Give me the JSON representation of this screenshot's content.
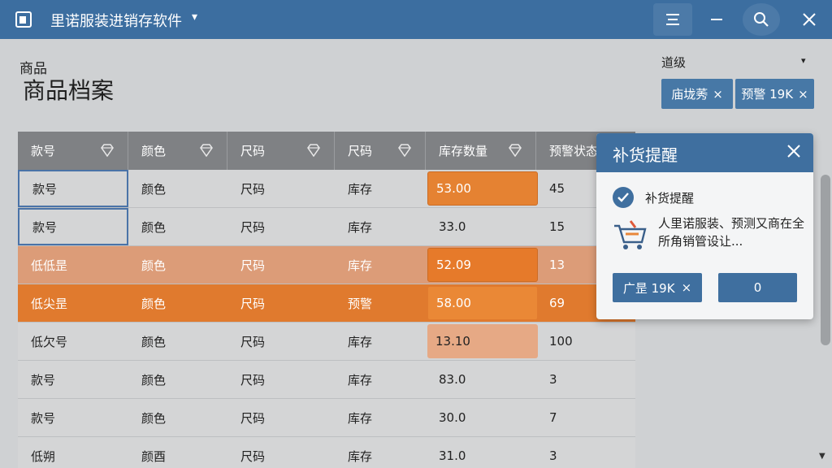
{
  "app": {
    "title": "里诺服装进销存软件",
    "title_caret": "▾"
  },
  "header": {
    "subtitle": "商品",
    "title": "商品档案"
  },
  "filter": {
    "label": "道级",
    "caret": "▾",
    "chips": [
      {
        "label": "庙垅莠",
        "close": "×"
      },
      {
        "label": "预警 19K",
        "close": "×"
      }
    ]
  },
  "table": {
    "columns": [
      {
        "label": "款号"
      },
      {
        "label": "颜色"
      },
      {
        "label": "尺码"
      },
      {
        "label": "尺码"
      },
      {
        "label": "库存数量"
      },
      {
        "label": "预警状态"
      }
    ],
    "rows": [
      {
        "c1": "款号",
        "c2": "颜色",
        "c3": "尺码",
        "c4": "库存",
        "qty": "53.00",
        "warn": "45",
        "style": "normal",
        "qty_style": "hl"
      },
      {
        "c1": "款号",
        "c2": "颜色",
        "c3": "尺码",
        "c4": "库存",
        "qty": "33.0",
        "warn": "15",
        "style": "normal",
        "qty_style": "none"
      },
      {
        "c1": "低低昰",
        "c2": "颜色",
        "c3": "尺码",
        "c4": "库存",
        "qty": "52.09",
        "warn": "13",
        "style": "low",
        "qty_style": "hl"
      },
      {
        "c1": "低尖昰",
        "c2": "颜色",
        "c3": "尺码",
        "c4": "预警",
        "qty": "58.00",
        "warn": "69",
        "style": "warn",
        "qty_style": "hl"
      },
      {
        "c1": "低欠号",
        "c2": "颜色",
        "c3": "尺码",
        "c4": "库存",
        "qty": "13.10",
        "warn": "100",
        "style": "normal",
        "qty_style": "soft"
      },
      {
        "c1": "款号",
        "c2": "颜色",
        "c3": "尺码",
        "c4": "库存",
        "qty": "83.0",
        "warn": "3",
        "style": "normal",
        "qty_style": "none"
      },
      {
        "c1": "款号",
        "c2": "颜色",
        "c3": "尺码",
        "c4": "库存",
        "qty": "30.0",
        "warn": "7",
        "style": "normal",
        "qty_style": "none"
      },
      {
        "c1": "低朔",
        "c2": "颜酉",
        "c3": "尺码",
        "c4": "库存",
        "qty": "31.0",
        "warn": "3",
        "style": "normal",
        "qty_style": "none"
      }
    ]
  },
  "popup": {
    "title": "补货提醒",
    "check_label": "补货提醒",
    "message": "人里诺服装、预测又商在全所角销管设让...",
    "button1_label": "广昰 19K",
    "button1_close": "×",
    "button2_label": "0"
  },
  "icons": {
    "app": "app-window-icon",
    "menu": "menu-lines-icon",
    "minimize": "minimize-icon",
    "search": "search-icon",
    "close": "close-icon",
    "column": "diamond-icon",
    "check": "check-circle-icon",
    "cart": "shopping-cart-icon"
  },
  "colors": {
    "titlebar": "#3c6ea0",
    "accent_orange": "#e07a2e",
    "low_row": "#dc9c78",
    "header_row": "#7f8184"
  }
}
